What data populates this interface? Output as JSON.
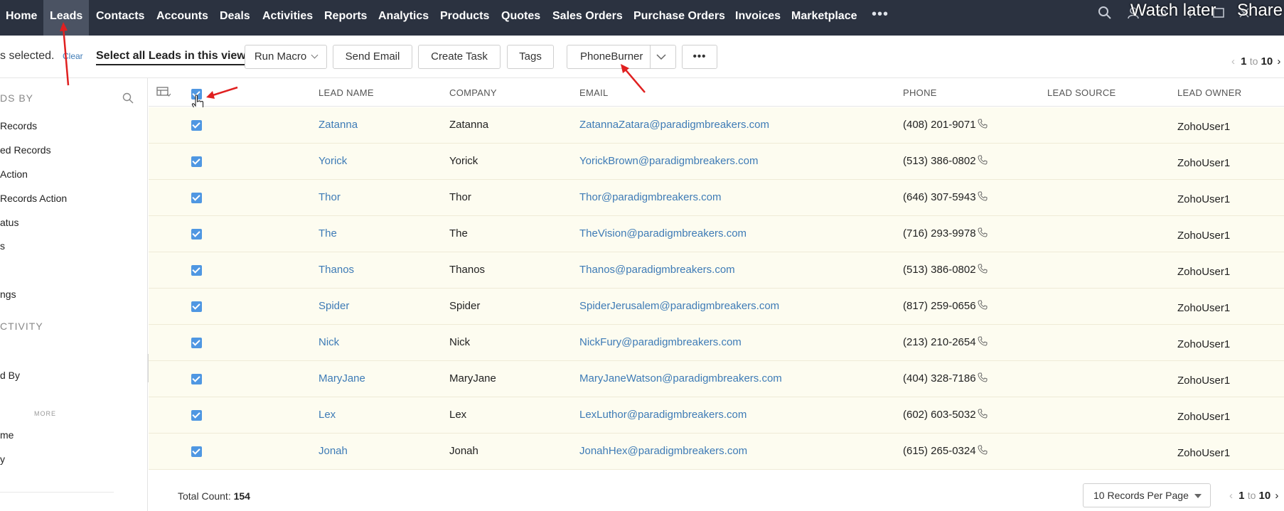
{
  "nav": {
    "items": [
      {
        "label": "Home",
        "active": false
      },
      {
        "label": "Leads",
        "active": true
      },
      {
        "label": "Contacts",
        "active": false
      },
      {
        "label": "Accounts",
        "active": false
      },
      {
        "label": "Deals",
        "active": false
      },
      {
        "label": "Activities",
        "active": false
      },
      {
        "label": "Reports",
        "active": false
      },
      {
        "label": "Analytics",
        "active": false
      },
      {
        "label": "Products",
        "active": false
      },
      {
        "label": "Quotes",
        "active": false
      },
      {
        "label": "Sales Orders",
        "active": false
      },
      {
        "label": "Purchase Orders",
        "active": false
      },
      {
        "label": "Invoices",
        "active": false
      },
      {
        "label": "Marketplace",
        "active": false
      }
    ],
    "more": "•••",
    "icons": [
      "search-icon",
      "user-icon",
      "bell-icon",
      "setup-icon",
      "window-icon",
      "close-icon"
    ]
  },
  "overlay": {
    "watch_later": "Watch later",
    "share": "Share"
  },
  "toolbar": {
    "selected_text": "s selected.",
    "clear": "Clear",
    "select_all": "Select all Leads in this view",
    "run_macro": "Run Macro",
    "send_email": "Send Email",
    "create_task": "Create Task",
    "tags": "Tags",
    "phoneburner": "PhoneBurner",
    "more": "•••"
  },
  "pager_top": {
    "from": "1",
    "to_word": "to",
    "to": "10"
  },
  "sidebar": {
    "heading1": "DS BY",
    "items1": [
      "Records",
      "ed Records",
      "Action",
      "Records Action",
      "atus",
      "s",
      "ngs"
    ],
    "heading2": "CTIVITY",
    "items2": [
      "d By"
    ],
    "more": "MORE",
    "items3": [
      "me",
      "y"
    ]
  },
  "table": {
    "headers": {
      "lead_name": "LEAD NAME",
      "company": "COMPANY",
      "email": "EMAIL",
      "phone": "PHONE",
      "lead_source": "LEAD SOURCE",
      "lead_owner": "LEAD OWNER"
    },
    "rows": [
      {
        "name": "Zatanna",
        "company": "Zatanna",
        "email": "ZatannaZatara@paradigmbreakers.com",
        "phone": "(408) 201-9071",
        "source": "",
        "owner": "ZohoUser1",
        "checked": true
      },
      {
        "name": "Yorick",
        "company": "Yorick",
        "email": "YorickBrown@paradigmbreakers.com",
        "phone": "(513) 386-0802",
        "source": "",
        "owner": "ZohoUser1",
        "checked": true
      },
      {
        "name": "Thor",
        "company": "Thor",
        "email": "Thor@paradigmbreakers.com",
        "phone": "(646) 307-5943",
        "source": "",
        "owner": "ZohoUser1",
        "checked": true
      },
      {
        "name": "The",
        "company": "The",
        "email": "TheVision@paradigmbreakers.com",
        "phone": "(716) 293-9978",
        "source": "",
        "owner": "ZohoUser1",
        "checked": true
      },
      {
        "name": "Thanos",
        "company": "Thanos",
        "email": "Thanos@paradigmbreakers.com",
        "phone": "(513) 386-0802",
        "source": "",
        "owner": "ZohoUser1",
        "checked": true
      },
      {
        "name": "Spider",
        "company": "Spider",
        "email": "SpiderJerusalem@paradigmbreakers.com",
        "phone": "(817) 259-0656",
        "source": "",
        "owner": "ZohoUser1",
        "checked": true
      },
      {
        "name": "Nick",
        "company": "Nick",
        "email": "NickFury@paradigmbreakers.com",
        "phone": "(213) 210-2654",
        "source": "",
        "owner": "ZohoUser1",
        "checked": true
      },
      {
        "name": "MaryJane",
        "company": "MaryJane",
        "email": "MaryJaneWatson@paradigmbreakers.com",
        "phone": "(404) 328-7186",
        "source": "",
        "owner": "ZohoUser1",
        "checked": true
      },
      {
        "name": "Lex",
        "company": "Lex",
        "email": "LexLuthor@paradigmbreakers.com",
        "phone": "(602) 603-5032",
        "source": "",
        "owner": "ZohoUser1",
        "checked": true
      },
      {
        "name": "Jonah",
        "company": "Jonah",
        "email": "JonahHex@paradigmbreakers.com",
        "phone": "(615) 265-0324",
        "source": "",
        "owner": "ZohoUser1",
        "checked": true
      }
    ]
  },
  "footer": {
    "total_label": "Total Count:",
    "total_value": "154",
    "per_page": "10 Records Per Page",
    "from": "1",
    "to_word": "to",
    "to": "10"
  },
  "colors": {
    "nav_bg": "#2b3240",
    "nav_active": "#4b5363",
    "link": "#3e7bb6",
    "checkbox": "#4f97e2",
    "row_bg": "#fdfcf0",
    "annotation": "#e02020"
  }
}
